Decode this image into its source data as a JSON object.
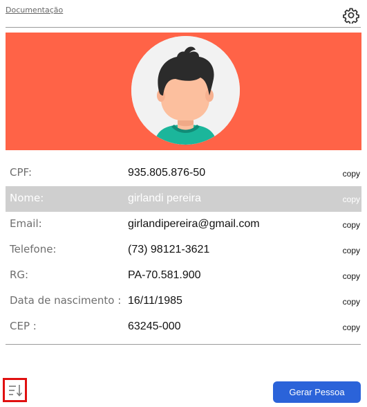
{
  "header": {
    "doc_link": "Documentação",
    "settings_icon": "gear-icon"
  },
  "banner": {
    "color": "#ff6347",
    "avatar_icon": "person-avatar"
  },
  "fields": [
    {
      "label": "CPF:",
      "value": "935.805.876-50",
      "action": "copy",
      "highlighted": false
    },
    {
      "label": "Nome:",
      "value": "girlandi pereira",
      "action": "copy",
      "highlighted": true
    },
    {
      "label": "Email:",
      "value": "girlandipereira@gmail.com",
      "action": "copy",
      "highlighted": false
    },
    {
      "label": "Telefone:",
      "value": "(73) 98121-3621",
      "action": "copy",
      "highlighted": false
    },
    {
      "label": "RG:",
      "value": "PA-70.581.900",
      "action": "copy",
      "highlighted": false
    },
    {
      "label": "Data de nascimento :",
      "value": "16/11/1985",
      "action": "copy",
      "highlighted": false
    },
    {
      "label": "CEP :",
      "value": "63245-000",
      "action": "copy",
      "highlighted": false
    }
  ],
  "footer": {
    "sort_icon": "sort-down-icon",
    "generate_button": "Gerar Pessoa",
    "button_color": "#2b63d9"
  }
}
